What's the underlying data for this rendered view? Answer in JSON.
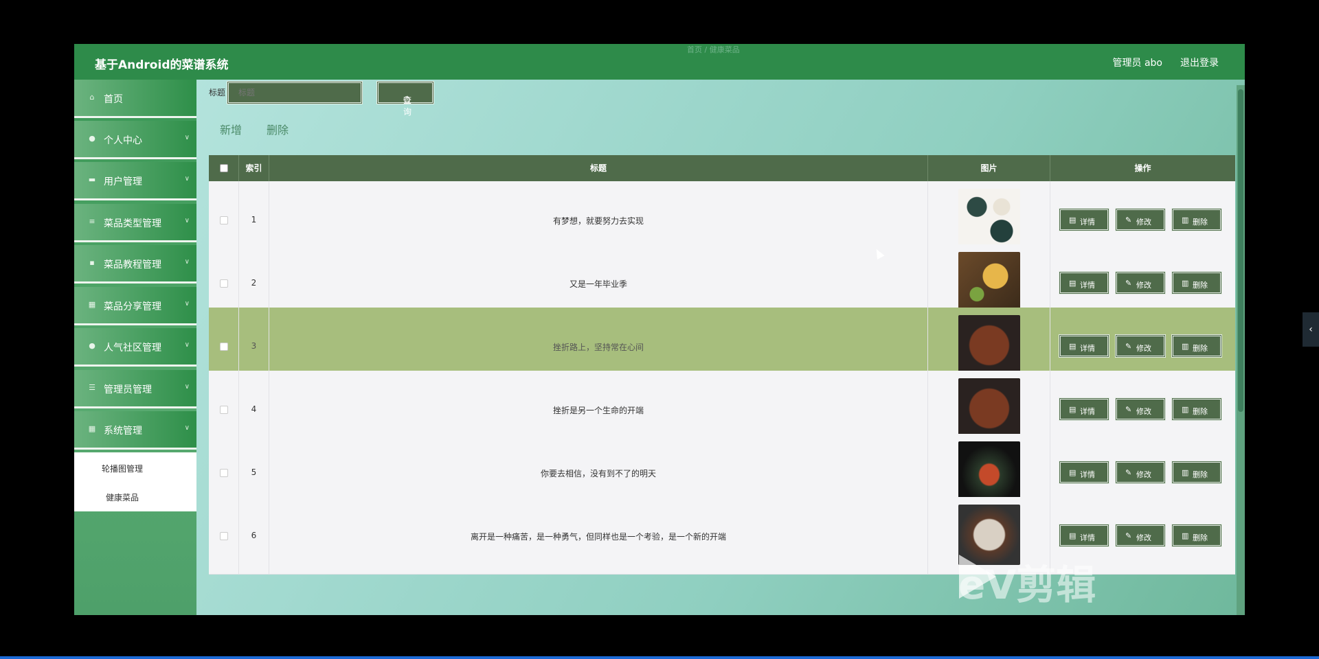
{
  "header": {
    "app_title": "基于Android的菜谱系统",
    "breadcrumb": "首页 / 健康菜品",
    "user": "管理员 abo",
    "logout": "退出登录"
  },
  "sidebar": {
    "items": [
      {
        "label": "首页",
        "icon": "home-icon",
        "expandable": false
      },
      {
        "label": "个人中心",
        "icon": "user-icon",
        "expandable": true
      },
      {
        "label": "用户管理",
        "icon": "monitor-icon",
        "expandable": true
      },
      {
        "label": "菜品类型管理",
        "icon": "list-icon",
        "expandable": true
      },
      {
        "label": "菜品教程管理",
        "icon": "book-icon",
        "expandable": true
      },
      {
        "label": "菜品分享管理",
        "icon": "grid-icon",
        "expandable": true
      },
      {
        "label": "人气社区管理",
        "icon": "location-icon",
        "expandable": true
      },
      {
        "label": "管理员管理",
        "icon": "sliders-icon",
        "expandable": true
      },
      {
        "label": "系统管理",
        "icon": "grid-icon",
        "expandable": true
      }
    ],
    "submenu": [
      {
        "label": "轮播图管理"
      },
      {
        "label": "健康菜品"
      }
    ]
  },
  "search": {
    "label": "标题",
    "placeholder": "标题",
    "button": "查询"
  },
  "actions": {
    "add": "新增",
    "delete": "删除"
  },
  "table": {
    "columns": [
      "索引",
      "标题",
      "图片",
      "操作"
    ],
    "buttons": {
      "detail": "详情",
      "edit": "修改",
      "delete": "删除"
    },
    "rows": [
      {
        "index": "1",
        "title": "有梦想，就要努力去实现",
        "image": "food-plates-top-view"
      },
      {
        "index": "2",
        "title": "又是一年毕业季",
        "image": "cheese-grapes-board"
      },
      {
        "index": "3",
        "title": "挫折路上，坚持常在心间",
        "image": "grilled-meat-skewers"
      },
      {
        "index": "4",
        "title": "挫折是另一个生命的开端",
        "image": "grilled-meat-skewers"
      },
      {
        "index": "5",
        "title": "你要去相信，没有到不了的明天",
        "image": "skewer-dark"
      },
      {
        "index": "6",
        "title": "离开是一种痛苦，是一种勇气，但同样也是一个考验，是一个新的开端",
        "image": "plated-dish"
      }
    ]
  },
  "watermark": "eV剪辑",
  "colors": {
    "header": "#2e8b4a",
    "table_header": "#4f6b4a",
    "highlight_row": "#a7be7d",
    "button": "#4f6b4a"
  }
}
